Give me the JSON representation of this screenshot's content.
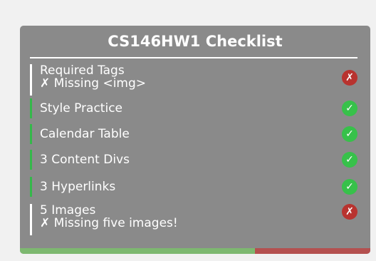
{
  "checklist": {
    "title": "CS146HW1 Checklist",
    "items": [
      {
        "label": "Required Tags",
        "detail": "✗ Missing <img>",
        "status": "fail",
        "status_icon": "✗"
      },
      {
        "label": "Style Practice",
        "detail": "",
        "status": "pass",
        "status_icon": "✓"
      },
      {
        "label": "Calendar Table",
        "detail": "",
        "status": "pass",
        "status_icon": "✓"
      },
      {
        "label": "3 Content Divs",
        "detail": "",
        "status": "pass",
        "status_icon": "✓"
      },
      {
        "label": "3 Hyperlinks",
        "detail": "",
        "status": "pass",
        "status_icon": "✓"
      },
      {
        "label": "5 Images",
        "detail": "✗ Missing five images!",
        "status": "fail",
        "status_icon": "✗"
      }
    ],
    "progress": {
      "passed_fraction": 0.67
    }
  },
  "colors": {
    "panel_bg": "#8a8a8a",
    "pass": "#37c14a",
    "fail": "#b8332f",
    "pass_bar": "#35b84a",
    "fail_bar": "#ffffff"
  }
}
